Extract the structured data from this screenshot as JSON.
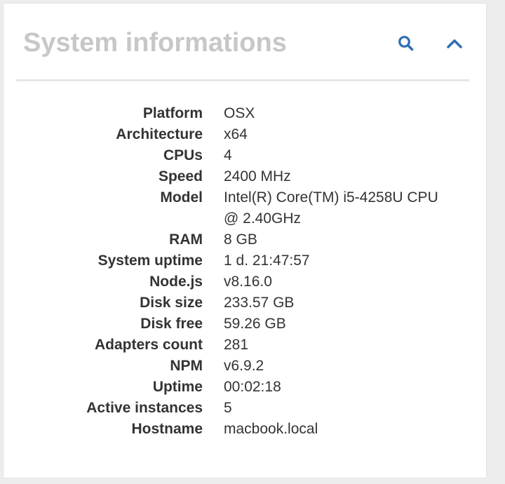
{
  "panel": {
    "title": "System informations",
    "accent_color": "#2f6fb2",
    "tools": [
      {
        "icon": "search-icon"
      },
      {
        "icon": "chevron-up-icon"
      }
    ]
  },
  "info": [
    {
      "label": "Platform",
      "value": "OSX"
    },
    {
      "label": "Architecture",
      "value": "x64"
    },
    {
      "label": "CPUs",
      "value": "4"
    },
    {
      "label": "Speed",
      "value": "2400 MHz"
    },
    {
      "label": "Model",
      "value": "Intel(R) Core(TM) i5-4258U CPU @ 2.40GHz"
    },
    {
      "label": "RAM",
      "value": "8 GB"
    },
    {
      "label": "System uptime",
      "value": "1 d. 21:47:57"
    },
    {
      "label": "Node.js",
      "value": "v8.16.0"
    },
    {
      "label": "Disk size",
      "value": "233.57 GB"
    },
    {
      "label": "Disk free",
      "value": "59.26 GB"
    },
    {
      "label": "Adapters count",
      "value": "281"
    },
    {
      "label": "NPM",
      "value": "v6.9.2"
    },
    {
      "label": "Uptime",
      "value": "00:02:18"
    },
    {
      "label": "Active instances",
      "value": "5"
    },
    {
      "label": "Hostname",
      "value": "macbook.local"
    }
  ]
}
